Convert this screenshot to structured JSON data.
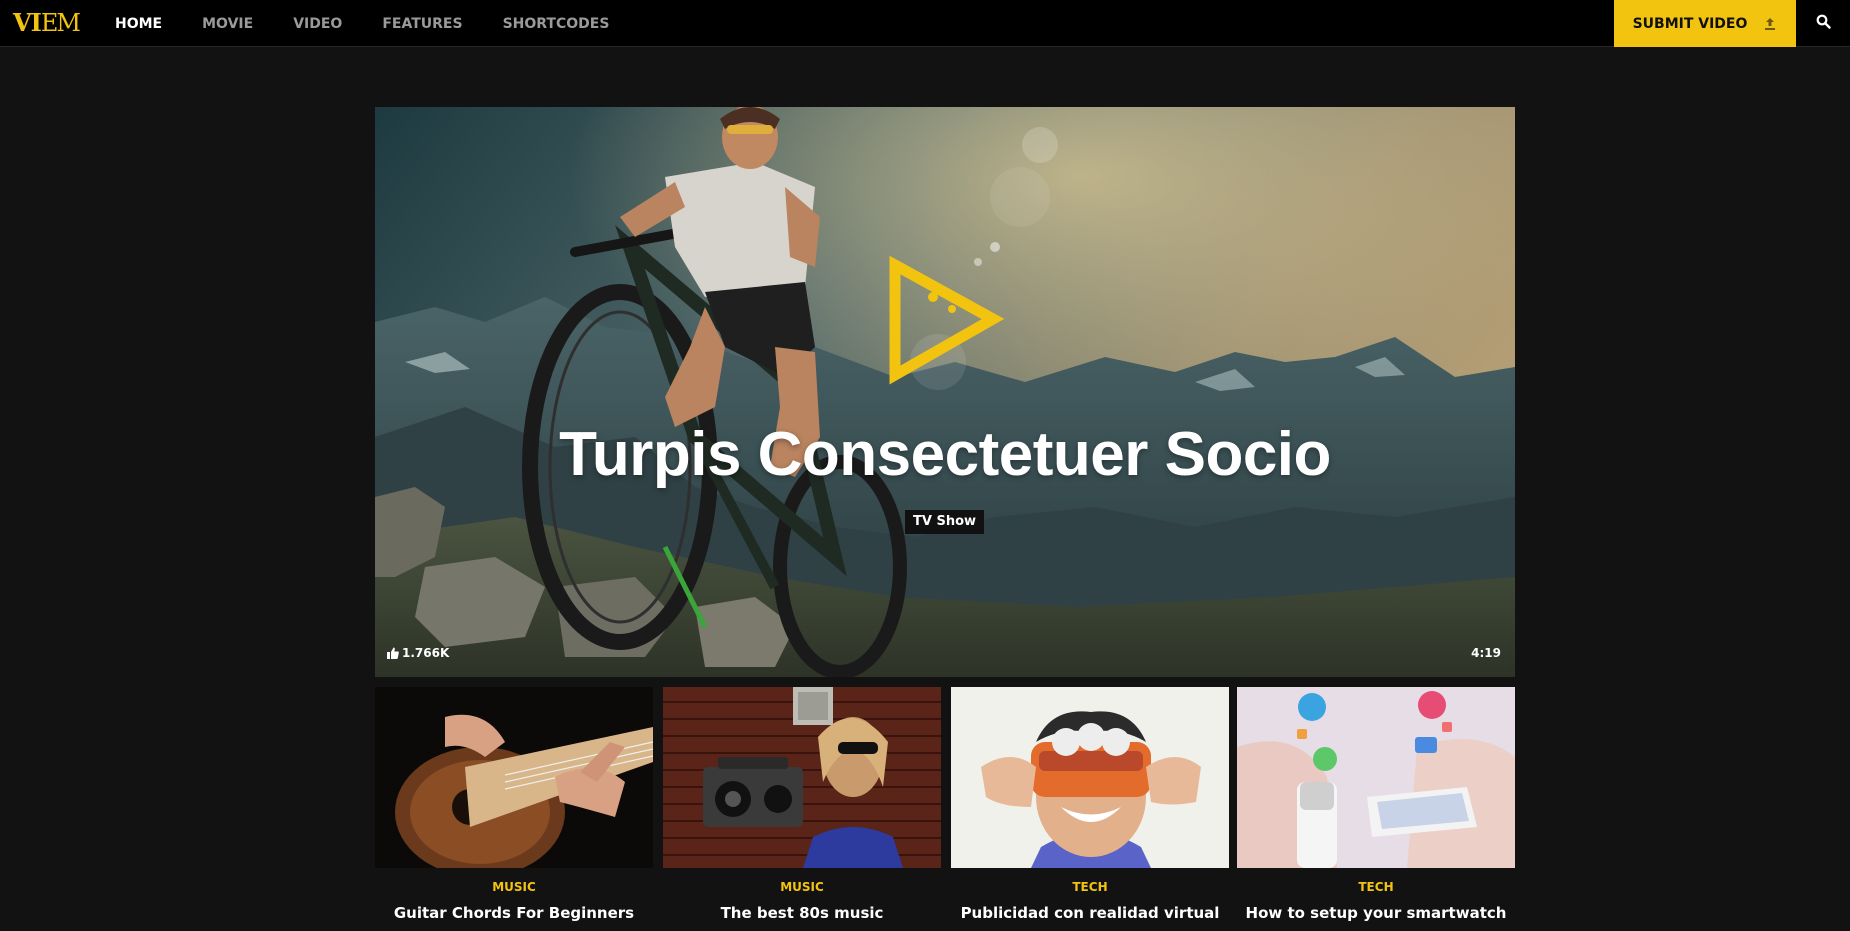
{
  "brand": {
    "logo_text_a": "VI",
    "logo_text_b": "EM",
    "accent_color": "#f2c40f",
    "background_color": "#121212",
    "topbar_color": "#000000"
  },
  "nav": {
    "items": [
      {
        "label": "HOME",
        "active": true
      },
      {
        "label": "MOVIE",
        "active": false
      },
      {
        "label": "VIDEO",
        "active": false
      },
      {
        "label": "FEATURES",
        "active": false
      },
      {
        "label": "SHORTCODES",
        "active": false
      }
    ],
    "submit_label": "SUBMIT VIDEO",
    "submit_icon": "upload-icon",
    "search_icon": "search-icon"
  },
  "hero": {
    "title": "Turpis Consectetuer Socio",
    "badge": "TV Show",
    "likes": "1.766K",
    "likes_icon": "thumbs-up-icon",
    "duration": "4:19",
    "play_icon": "play-icon"
  },
  "cards": [
    {
      "category": "MUSIC",
      "title": "Guitar Chords For Beginners",
      "thumb": "guitar-thumbnail"
    },
    {
      "category": "MUSIC",
      "title": "The best 80s music",
      "thumb": "boombox-thumbnail"
    },
    {
      "category": "TECH",
      "title": "Publicidad con realidad virtual",
      "thumb": "viewmaster-thumbnail"
    },
    {
      "category": "TECH",
      "title": "How to setup your smartwatch",
      "thumb": "smartwatch-thumbnail"
    }
  ]
}
